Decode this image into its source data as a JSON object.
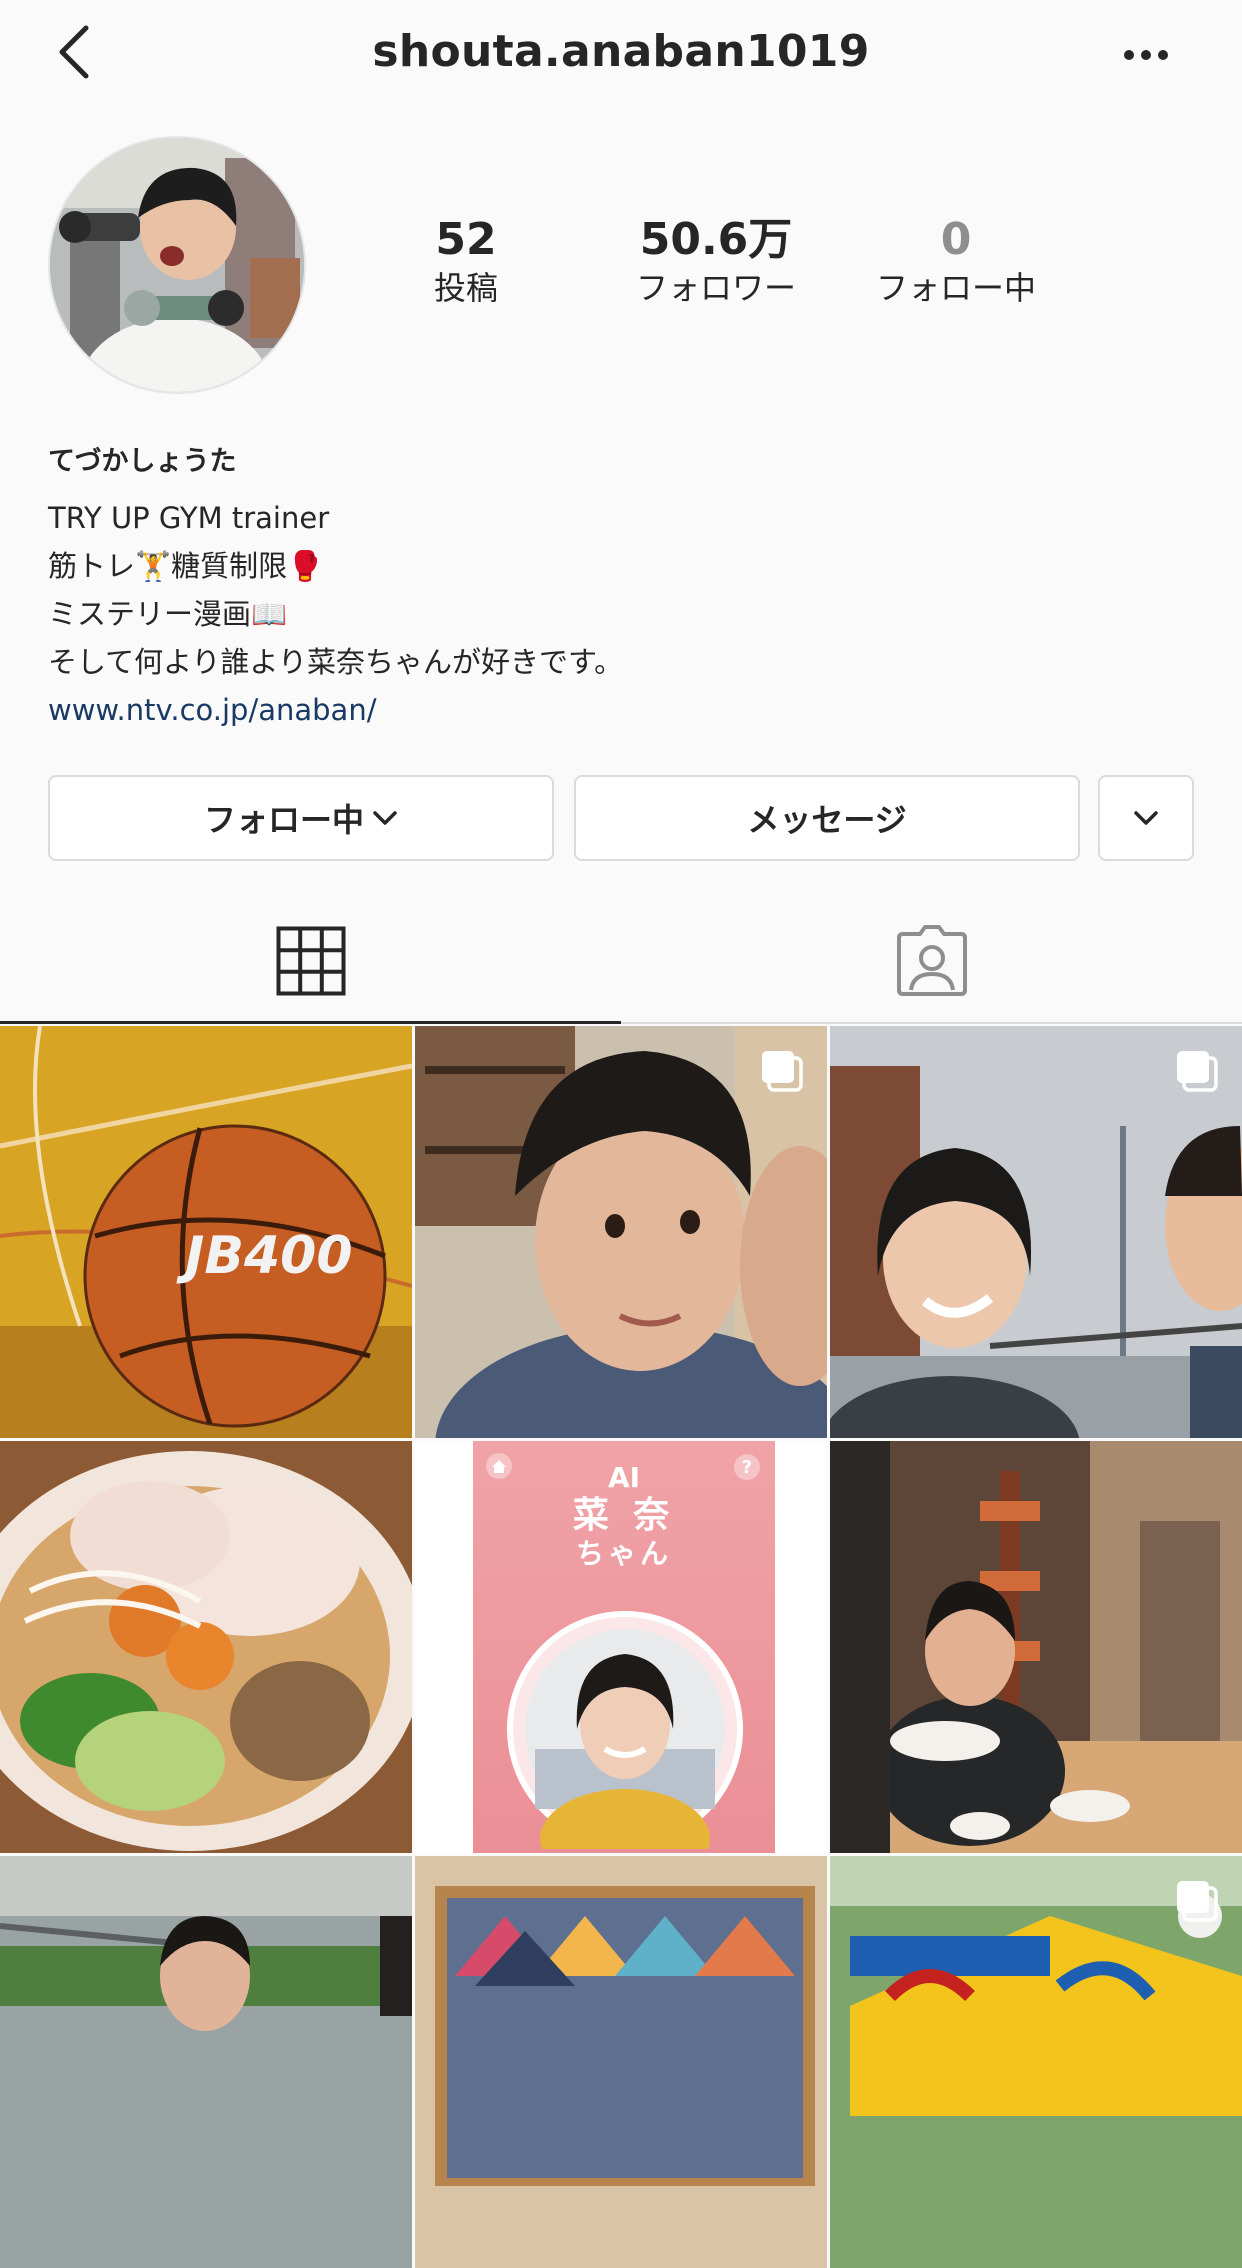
{
  "header": {
    "username": "shouta.anaban1019",
    "back_icon": "chevron-left-icon",
    "more_icon": "more-horizontal-icon"
  },
  "stats": [
    {
      "value": "52",
      "label": "投稿"
    },
    {
      "value": "50.6万",
      "label": "フォロワー"
    },
    {
      "value": "0",
      "label": "フォロー中"
    }
  ],
  "bio": {
    "name": "てづかしょうた",
    "lines": [
      "TRY UP GYM trainer",
      "筋トレ🏋️糖質制限🥊",
      "ミステリー漫画📖",
      "そして何より誰より菜奈ちゃんが好きです。"
    ],
    "link": "www.ntv.co.jp/anaban/"
  },
  "buttons": {
    "following": "フォロー中",
    "message": "メッセージ"
  },
  "tabs": {
    "grid_icon": "grid-icon",
    "tagged_icon": "tagged-person-icon"
  },
  "posts": {
    "post_5": {
      "title": "AI",
      "line1": "菜 奈",
      "line2": "ちゃん"
    }
  },
  "colors": {
    "background": "#fafafa",
    "link": "#1a3a66",
    "border": "#dbdbdb",
    "text": "#262626",
    "muted": "#8e8e8e"
  }
}
